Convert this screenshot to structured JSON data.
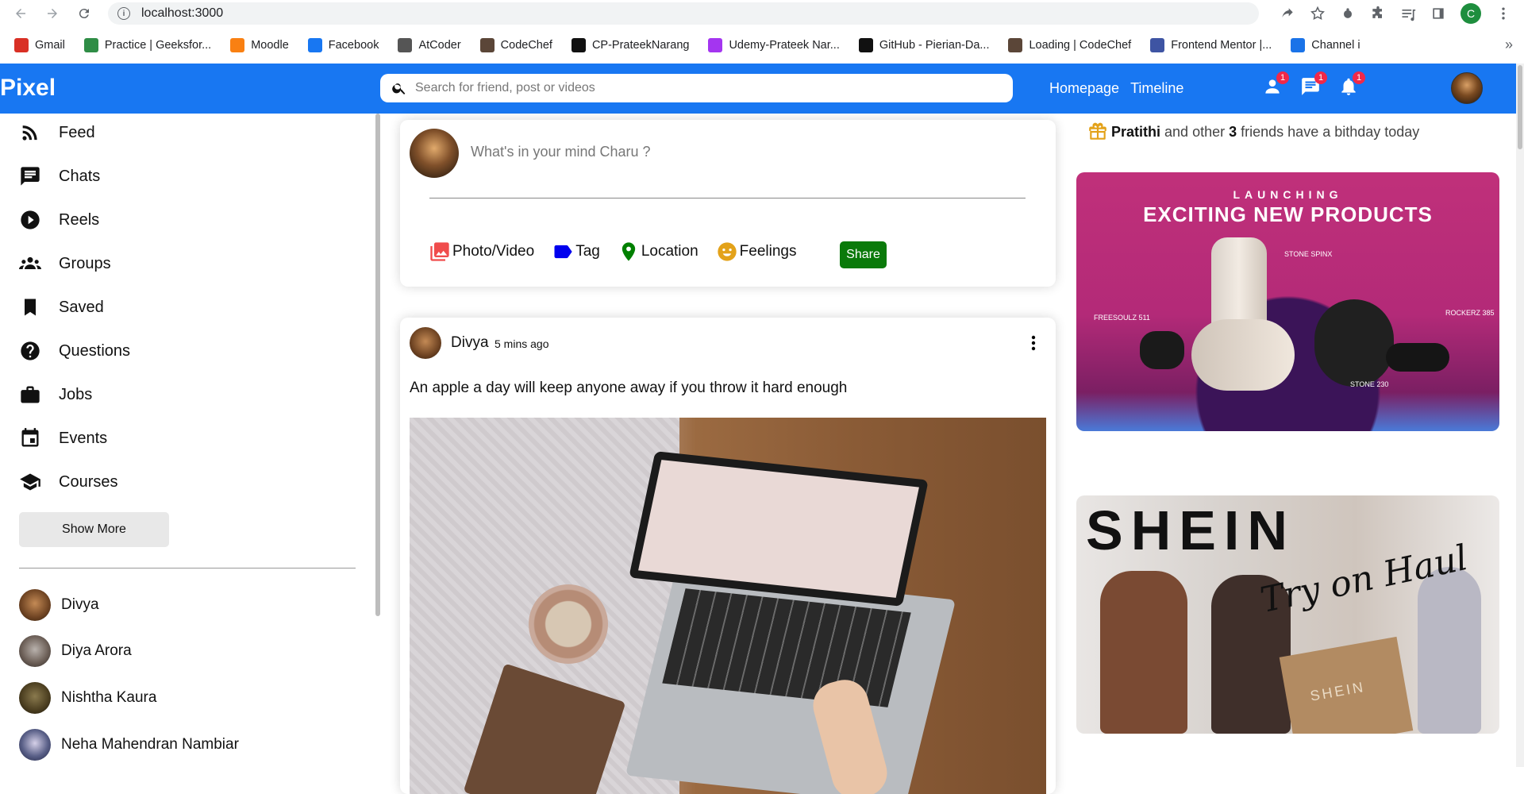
{
  "browser": {
    "url": "localhost:3000",
    "profile_initial": "C",
    "bookmarks": [
      {
        "label": "Gmail",
        "icon": "gmail-icon",
        "color": "#d93025"
      },
      {
        "label": "Practice | Geeksfor...",
        "icon": "geeksforgeeks-icon",
        "color": "#2f8d46"
      },
      {
        "label": "Moodle",
        "icon": "moodle-icon",
        "color": "#f98012"
      },
      {
        "label": "Facebook",
        "icon": "facebook-icon",
        "color": "#1877f2"
      },
      {
        "label": "AtCoder",
        "icon": "atcoder-icon",
        "color": "#555555"
      },
      {
        "label": "CodeChef",
        "icon": "codechef-icon",
        "color": "#5b4638"
      },
      {
        "label": "CP-PrateekNarang",
        "icon": "github-icon",
        "color": "#111111"
      },
      {
        "label": "Udemy-Prateek Nar...",
        "icon": "udemy-icon",
        "color": "#a435f0"
      },
      {
        "label": "GitHub - Pierian-Da...",
        "icon": "github-icon",
        "color": "#111111"
      },
      {
        "label": "Loading | CodeChef",
        "icon": "codechef-icon",
        "color": "#5b4638"
      },
      {
        "label": "Frontend Mentor |...",
        "icon": "frontend-mentor-icon",
        "color": "#3e54a3"
      },
      {
        "label": "Channel i",
        "icon": "channel-icon",
        "color": "#1a73e8"
      }
    ],
    "more_bookmarks": "»"
  },
  "topbar": {
    "logo": "Pixel",
    "search_placeholder": "Search for friend, post or videos",
    "links": [
      "Homepage",
      "Timeline"
    ],
    "badges": {
      "friends": "1",
      "messages": "1",
      "notifications": "1"
    },
    "accent_color": "#1877f2"
  },
  "sidebar": {
    "items": [
      {
        "label": "Feed",
        "icon": "rss-icon"
      },
      {
        "label": "Chats",
        "icon": "chat-icon"
      },
      {
        "label": "Reels",
        "icon": "play-circle-icon"
      },
      {
        "label": "Groups",
        "icon": "groups-icon"
      },
      {
        "label": "Saved",
        "icon": "bookmark-icon"
      },
      {
        "label": "Questions",
        "icon": "help-circle-icon"
      },
      {
        "label": "Jobs",
        "icon": "briefcase-icon"
      },
      {
        "label": "Events",
        "icon": "calendar-icon"
      },
      {
        "label": "Courses",
        "icon": "school-icon"
      }
    ],
    "show_more": "Show More",
    "friends": [
      {
        "name": "Divya"
      },
      {
        "name": "Diya Arora"
      },
      {
        "name": "Nishtha Kaura"
      },
      {
        "name": "Neha Mahendran Nambiar"
      }
    ]
  },
  "share": {
    "placeholder": "What's in your mind Charu ?",
    "options": [
      {
        "label": "Photo/Video",
        "icon": "photo-library-icon",
        "color": "#f04c4c"
      },
      {
        "label": "Tag",
        "icon": "label-icon",
        "color": "#0000ee"
      },
      {
        "label": "Location",
        "icon": "location-pin-icon",
        "color": "#008000"
      },
      {
        "label": "Feelings",
        "icon": "emoji-icon",
        "color": "#e3a21a"
      }
    ],
    "button": "Share",
    "button_color": "#0a7a0a"
  },
  "post": {
    "author": "Divya",
    "time": "5 mins ago",
    "text": "An apple a day will keep anyone away if you throw it hard enough"
  },
  "rightbar": {
    "birthday": {
      "name": "Pratithi",
      "middle": "and other",
      "count": "3",
      "suffix": "friends have a bithday today"
    },
    "ad1": {
      "kicker": "LAUNCHING",
      "headline": "EXCITING NEW PRODUCTS",
      "labels": [
        "STONE SPINX",
        "FREESOULZ 511",
        "ROCKERZ 385",
        "STONE 230"
      ]
    },
    "ad2": {
      "brand": "SHEIN",
      "script": "Try on Haul",
      "box": "SHEIN"
    }
  }
}
